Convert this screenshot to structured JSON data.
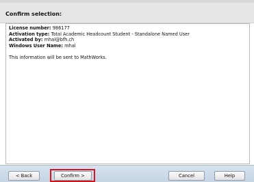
{
  "header": {
    "title": "Confirm selection:"
  },
  "details": {
    "license_label": "License number:",
    "license_value": "986177",
    "activation_label": "Activation type:",
    "activation_value": "Total Academic Headcount Student - Standalone Named User",
    "activated_by_label": "Activated by:",
    "activated_by_value": "mhal@bfh.ch",
    "windows_user_label": "Windows User Name:",
    "windows_user_value": "mhal"
  },
  "message": "This information will be sent to MathWorks.",
  "buttons": {
    "back": "< Back",
    "confirm": "Confirm >",
    "cancel": "Cancel",
    "help": "Help"
  },
  "colors": {
    "highlight": "#d4141c",
    "footer": "#c6d4e4"
  }
}
